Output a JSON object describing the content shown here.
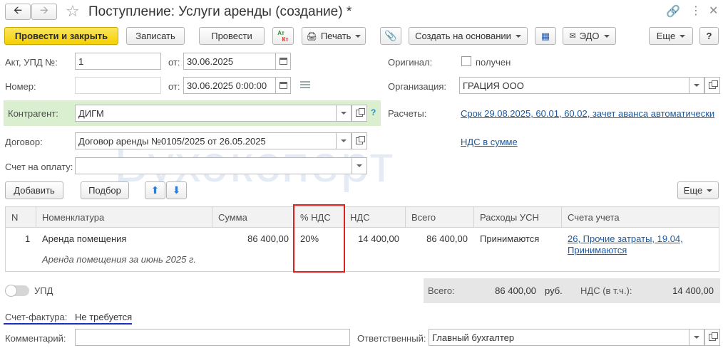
{
  "window": {
    "title": "Поступление: Услуги аренды (создание) *"
  },
  "toolbar": {
    "post_close": "Провести и закрыть",
    "save": "Записать",
    "post": "Провести",
    "dt_kt_top": "Ат",
    "dt_kt_bottom": "Кт",
    "print": "Печать",
    "create_basis": "Создать на основании",
    "edo": "ЭДО",
    "more": "Еще",
    "help": "?"
  },
  "form": {
    "act_label": "Акт, УПД №:",
    "act_value": "1",
    "from_label": "от:",
    "act_date": "30.06.2025",
    "number_label": "Номер:",
    "number_value": "",
    "from_label2": "от:",
    "number_date": "30.06.2025  0:00:00",
    "original_label": "Оригинал:",
    "received_label": "получен",
    "org_label": "Организация:",
    "org_value": "ГРАЦИЯ ООО",
    "counterparty_label": "Контрагент:",
    "counterparty_value": "ДИГМ",
    "settlements_label": "Расчеты:",
    "settlements_link": "Срок 29.08.2025, 60.01, 60.02, зачет аванса автоматически",
    "contract_label": "Договор:",
    "contract_value": "Договор аренды №0105/2025 от 26.05.2025",
    "vat_link": "НДС в сумме",
    "invoice_label": "Счет на оплату:",
    "invoice_value": ""
  },
  "table_toolbar": {
    "add": "Добавить",
    "pick": "Подбор",
    "more": "Еще"
  },
  "watermark": "Бухэксперт",
  "table": {
    "headers": [
      "N",
      "Номенклатура",
      "Сумма",
      "% НДС",
      "НДС",
      "Всего",
      "Расходы УСН",
      "Счета учета"
    ],
    "rows": [
      {
        "n": "1",
        "item": "Аренда помещения",
        "item_desc": "Аренда помещения за июнь 2025 г.",
        "sum": "86 400,00",
        "vat_rate": "20%",
        "vat": "14 400,00",
        "total": "86 400,00",
        "usn": "Принимаются",
        "accounts_line1": "26, Прочие затраты, 19.04,",
        "accounts_line2": "Принимаются"
      }
    ]
  },
  "footer": {
    "upd_label": "УПД",
    "total_label": "Всего:",
    "total_value": "86 400,00",
    "currency": "руб.",
    "vat_label": "НДС (в т.ч.):",
    "vat_value": "14 400,00",
    "invoice_label": "Счет-фактура:",
    "invoice_value": "Не требуется",
    "comment_label": "Комментарий:",
    "comment_value": "",
    "responsible_label": "Ответственный:",
    "responsible_value": "Главный бухгалтер"
  },
  "colors": {
    "primary_button": "#f5d000",
    "highlight_box": "#e0201c",
    "counterparty_bg": "#d9efcf",
    "link": "#1a5aa3",
    "underline_annotation": "#1c2fbf"
  }
}
